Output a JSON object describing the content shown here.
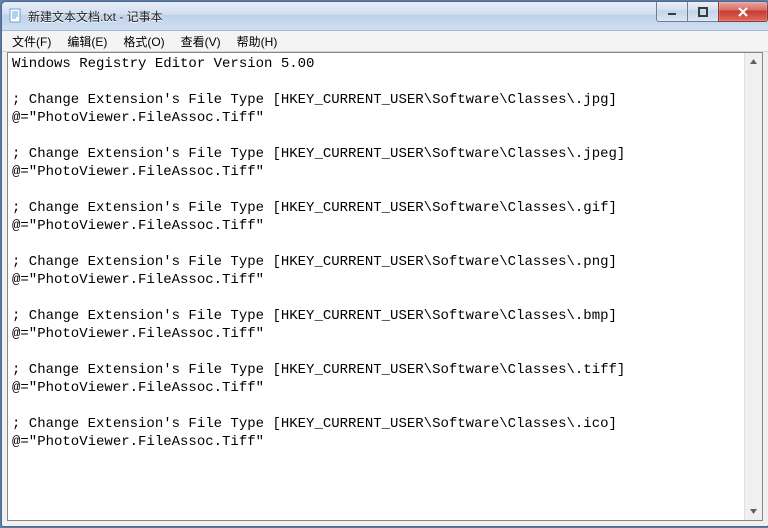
{
  "window": {
    "title": "新建文本文档.txt - 记事本"
  },
  "menu": {
    "file": "文件(F)",
    "edit": "编辑(E)",
    "format": "格式(O)",
    "view": "查看(V)",
    "help": "帮助(H)"
  },
  "editor": {
    "content": "Windows Registry Editor Version 5.00\n\n; Change Extension's File Type [HKEY_CURRENT_USER\\Software\\Classes\\.jpg]\n@=\"PhotoViewer.FileAssoc.Tiff\"\n\n; Change Extension's File Type [HKEY_CURRENT_USER\\Software\\Classes\\.jpeg]\n@=\"PhotoViewer.FileAssoc.Tiff\"\n\n; Change Extension's File Type [HKEY_CURRENT_USER\\Software\\Classes\\.gif]\n@=\"PhotoViewer.FileAssoc.Tiff\"\n\n; Change Extension's File Type [HKEY_CURRENT_USER\\Software\\Classes\\.png]\n@=\"PhotoViewer.FileAssoc.Tiff\"\n\n; Change Extension's File Type [HKEY_CURRENT_USER\\Software\\Classes\\.bmp]\n@=\"PhotoViewer.FileAssoc.Tiff\"\n\n; Change Extension's File Type [HKEY_CURRENT_USER\\Software\\Classes\\.tiff]\n@=\"PhotoViewer.FileAssoc.Tiff\"\n\n; Change Extension's File Type [HKEY_CURRENT_USER\\Software\\Classes\\.ico]\n@=\"PhotoViewer.FileAssoc.Tiff\""
  }
}
